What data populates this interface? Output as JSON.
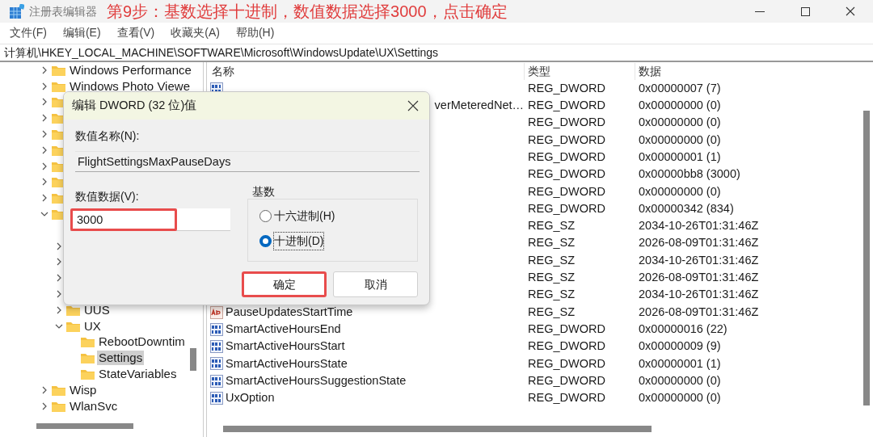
{
  "window": {
    "title": "注册表编辑器",
    "annotation": "第9步：基数选择十进制，数值数据选择3000，点击确定"
  },
  "menu": [
    "文件(F)",
    "编辑(E)",
    "查看(V)",
    "收藏夹(A)",
    "帮助(H)"
  ],
  "address": "计算机\\HKEY_LOCAL_MACHINE\\SOFTWARE\\Microsoft\\WindowsUpdate\\UX\\Settings",
  "tree": [
    {
      "label": "Windows Performance",
      "expanded": false,
      "selected": false
    },
    {
      "label": "Windows Photo Viewe",
      "expanded": false,
      "selected": false
    },
    {
      "expanded": false
    },
    {
      "expanded": false
    },
    {
      "expanded": false
    },
    {
      "expanded": false
    },
    {
      "expanded": false
    },
    {
      "expanded": false
    },
    {
      "expanded": false
    },
    {
      "expanded": true,
      "children": [
        {
          "kind": "leaf"
        },
        {
          "kind": "branch",
          "expanded": false
        },
        {
          "kind": "branch",
          "expanded": false
        },
        {
          "kind": "branch",
          "expanded": false
        },
        {
          "kind": "branch",
          "expanded": false
        },
        {
          "kind": "branch",
          "label": "UUS",
          "expanded": false,
          "selected": false
        },
        {
          "kind": "branch",
          "label": "UX",
          "expanded": true,
          "selected": false,
          "children": [
            {
              "label": "RebootDowntim",
              "selected": false
            },
            {
              "label": "Settings",
              "selected": true
            },
            {
              "label": "StateVariables",
              "selected": false
            }
          ]
        }
      ]
    },
    {
      "label": "Wisp",
      "expanded": false,
      "selected": false
    },
    {
      "label": "WlanSvc",
      "expanded": false,
      "selected": false
    }
  ],
  "table": {
    "columns": [
      "名称",
      "类型",
      "数据"
    ],
    "rows": [
      {
        "kind": "dword",
        "type": "REG_DWORD",
        "data": "0x00000007 (7)"
      },
      {
        "name": "verMeteredNet…",
        "clipped": true,
        "type": "REG_DWORD",
        "data": "0x00000000 (0)"
      },
      {
        "type": "REG_DWORD",
        "data": "0x00000000 (0)"
      },
      {
        "type": "REG_DWORD",
        "data": "0x00000000 (0)"
      },
      {
        "type": "REG_DWORD",
        "data": "0x00000001 (1)"
      },
      {
        "type": "REG_DWORD",
        "data": "0x00000bb8 (3000)"
      },
      {
        "type": "REG_DWORD",
        "data": "0x00000000 (0)"
      },
      {
        "type": "REG_DWORD",
        "data": "0x00000342 (834)"
      },
      {
        "type": "REG_SZ",
        "data": "2034-10-26T01:31:46Z"
      },
      {
        "type": "REG_SZ",
        "data": "2026-08-09T01:31:46Z"
      },
      {
        "type": "REG_SZ",
        "data": "2034-10-26T01:31:46Z"
      },
      {
        "type": "REG_SZ",
        "data": "2026-08-09T01:31:46Z"
      },
      {
        "type": "REG_SZ",
        "data": "2034-10-26T01:31:46Z"
      },
      {
        "kind": "string",
        "name": "PauseUpdatesStartTime",
        "type": "REG_SZ",
        "data": "2026-08-09T01:31:46Z"
      },
      {
        "kind": "dword",
        "name": "SmartActiveHoursEnd",
        "type": "REG_DWORD",
        "data": "0x00000016 (22)"
      },
      {
        "kind": "dword",
        "name": "SmartActiveHoursStart",
        "type": "REG_DWORD",
        "data": "0x00000009 (9)"
      },
      {
        "kind": "dword",
        "name": "SmartActiveHoursState",
        "type": "REG_DWORD",
        "data": "0x00000001 (1)"
      },
      {
        "kind": "dword",
        "name": "SmartActiveHoursSuggestionState",
        "type": "REG_DWORD",
        "data": "0x00000000 (0)"
      },
      {
        "kind": "dword",
        "name": "UxOption",
        "type": "REG_DWORD",
        "data": "0x00000000 (0)"
      }
    ]
  },
  "dialog": {
    "title": "编辑 DWORD (32 位)值",
    "name_label": "数值名称(N):",
    "name_value": "FlightSettingsMaxPauseDays",
    "data_label": "数值数据(V):",
    "data_value": "3000",
    "data_highlighted": true,
    "base_label": "基数",
    "bases": [
      {
        "label": "十六进制(H)",
        "selected": false
      },
      {
        "label": "十进制(D)",
        "selected": true
      }
    ],
    "buttons": [
      {
        "label": "确定",
        "highlighted": true
      },
      {
        "label": "取消",
        "highlighted": false
      }
    ]
  }
}
